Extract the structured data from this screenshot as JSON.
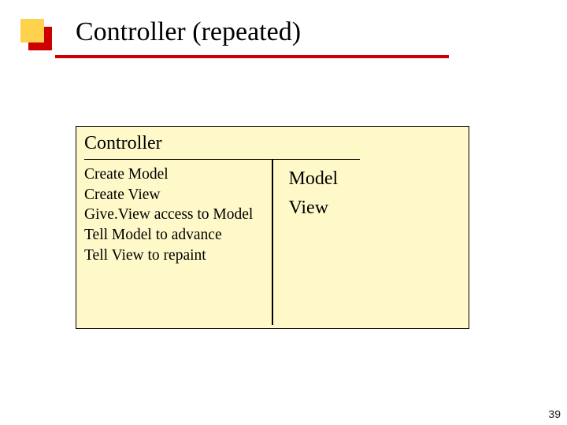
{
  "header": {
    "title": "Controller (repeated)"
  },
  "panel": {
    "class_name": "Controller",
    "left": {
      "line1": "Create Model",
      "line2": "Create View",
      "line3": "Give.View access to Model",
      "line4": "Tell Model to advance",
      "line5": "Tell View to repaint"
    },
    "right": {
      "line1": "Model",
      "line2": "View"
    }
  },
  "footer": {
    "page_number": "39"
  }
}
